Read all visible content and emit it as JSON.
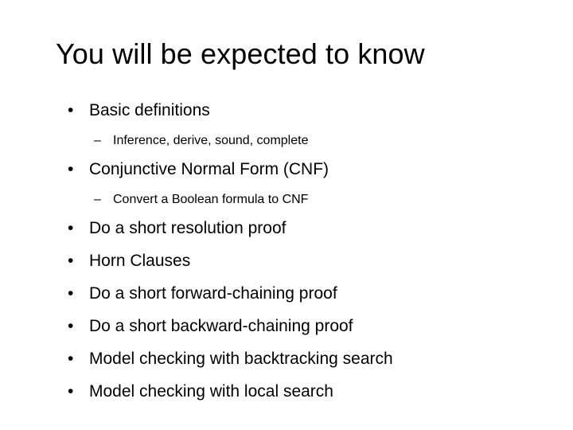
{
  "slide": {
    "title": "You will be expected to know",
    "background_color": "#ffffff",
    "text_color": "#000000",
    "markers": {
      "level1": "•",
      "level2": "–"
    },
    "bullets": [
      {
        "level": 1,
        "text": "Basic definitions"
      },
      {
        "level": 2,
        "text": "Inference, derive, sound, complete"
      },
      {
        "level": 1,
        "text": "Conjunctive Normal Form (CNF)"
      },
      {
        "level": 2,
        "text": "Convert a Boolean formula to CNF"
      },
      {
        "level": 1,
        "text": "Do a short resolution proof"
      },
      {
        "level": 1,
        "text": "Horn Clauses"
      },
      {
        "level": 1,
        "text": "Do a short forward-chaining proof"
      },
      {
        "level": 1,
        "text": "Do a short backward-chaining proof"
      },
      {
        "level": 1,
        "text": "Model checking with backtracking search"
      },
      {
        "level": 1,
        "text": "Model checking with local search"
      }
    ]
  }
}
